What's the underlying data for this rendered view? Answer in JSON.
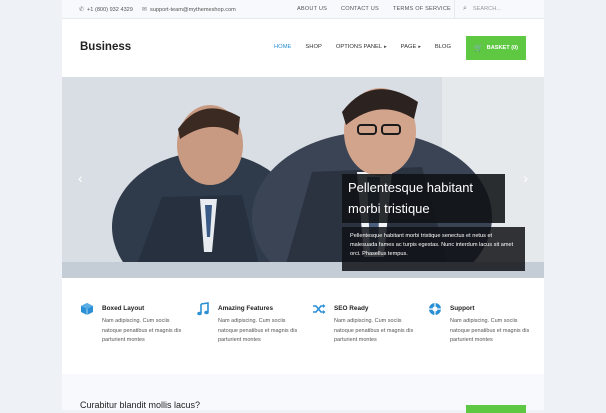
{
  "topbar": {
    "phone": "+1 (800) 932 4329",
    "email": "support-team@mythemeshop.com",
    "links": [
      "ABOUT US",
      "CONTACT US",
      "TERMS OF SERVICE"
    ],
    "search_placeholder": "SEARCH..."
  },
  "header": {
    "logo": "Business",
    "nav": [
      {
        "label": "HOME",
        "active": true
      },
      {
        "label": "SHOP"
      },
      {
        "label": "OPTIONS PANEL",
        "caret": "▸"
      },
      {
        "label": "PAGE",
        "caret": "▸"
      },
      {
        "label": "BLOG"
      }
    ],
    "basket_label": "BASKET (0)"
  },
  "hero": {
    "title": "Pellentesque habitant morbi tristique",
    "text": "Pellentesque habitant morbi tristique senectus et netus et malesuada fames ac turpis egestas. Nunc interdum lacus sit amet orci. Phasellus tempus.",
    "prev": "‹",
    "next": "›"
  },
  "features": [
    {
      "title": "Boxed Layout",
      "desc": "Nam adipiscing. Cum sociis natoque penatibus et magnis dis parturient montes",
      "icon": "cube-icon"
    },
    {
      "title": "Amazing Features",
      "desc": "Nam adipiscing. Cum sociis natoque penatibus et magnis dis parturient montes",
      "icon": "music-note-icon"
    },
    {
      "title": "SEO Ready",
      "desc": "Nam adipiscing. Cum sociis natoque penatibus et magnis dis parturient montes",
      "icon": "shuffle-icon"
    },
    {
      "title": "Support",
      "desc": "Nam adipiscing. Cum sociis natoque penatibus et magnis dis parturient montes",
      "icon": "lifebuoy-icon"
    }
  ],
  "bottom": {
    "question": "Curabitur blandit mollis lacus?"
  },
  "colors": {
    "accent": "#2a8fd4",
    "green": "#5fc843",
    "caption_bg": "#0f1216"
  }
}
